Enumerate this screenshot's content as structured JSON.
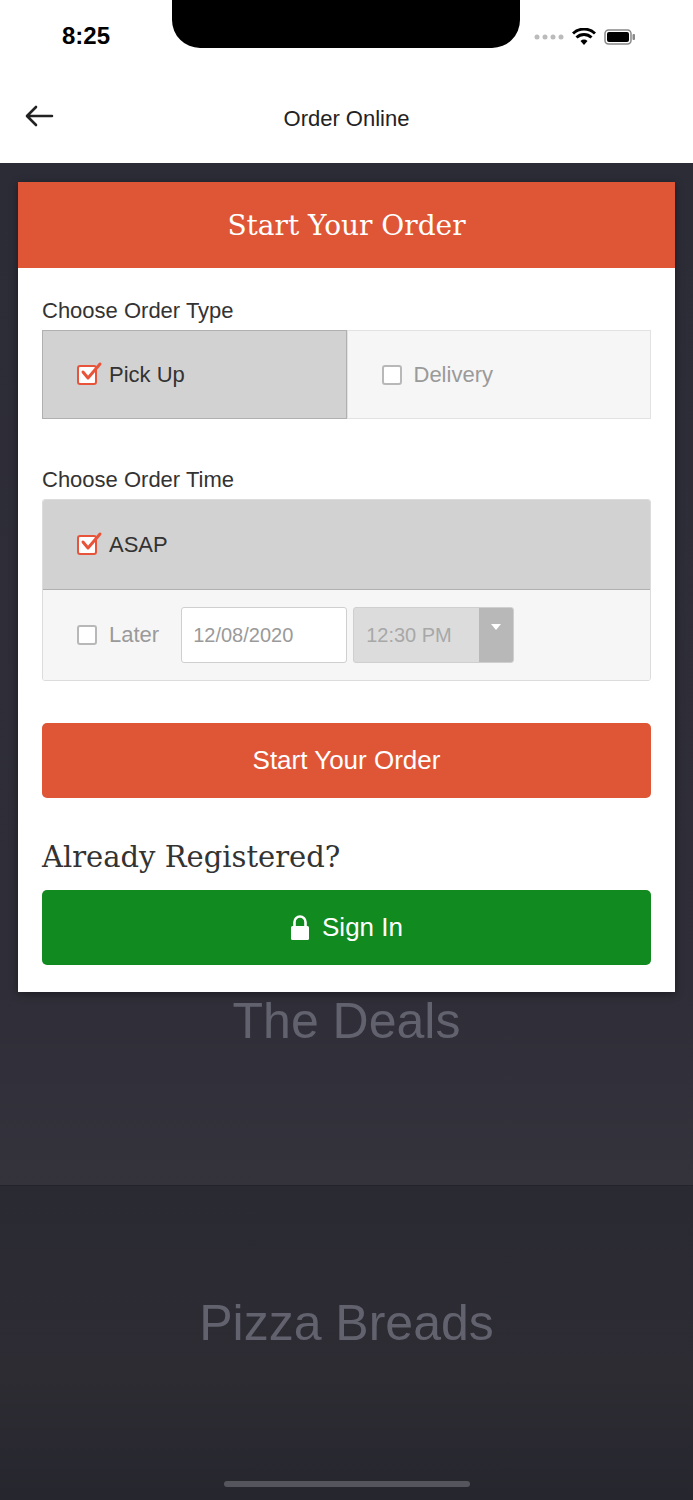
{
  "status_bar": {
    "time": "8:25"
  },
  "header": {
    "title": "Order Online"
  },
  "card": {
    "title": "Start Your Order"
  },
  "order_type": {
    "label": "Choose Order Type",
    "options": [
      {
        "label": "Pick Up",
        "selected": true
      },
      {
        "label": "Delivery",
        "selected": false
      }
    ]
  },
  "order_time": {
    "label": "Choose Order Time",
    "options": [
      {
        "label": "ASAP",
        "selected": true,
        "kind": "plain"
      },
      {
        "label": "Later",
        "selected": false,
        "kind": "scheduled",
        "date": "12/08/2020",
        "time": "12:30 PM"
      }
    ]
  },
  "start_button": "Start Your Order",
  "sign_in": {
    "heading": "Already Registered?",
    "button": "Sign In"
  },
  "categories": [
    {
      "label": "The Deals"
    },
    {
      "label": "Pizza Breads"
    }
  ]
}
